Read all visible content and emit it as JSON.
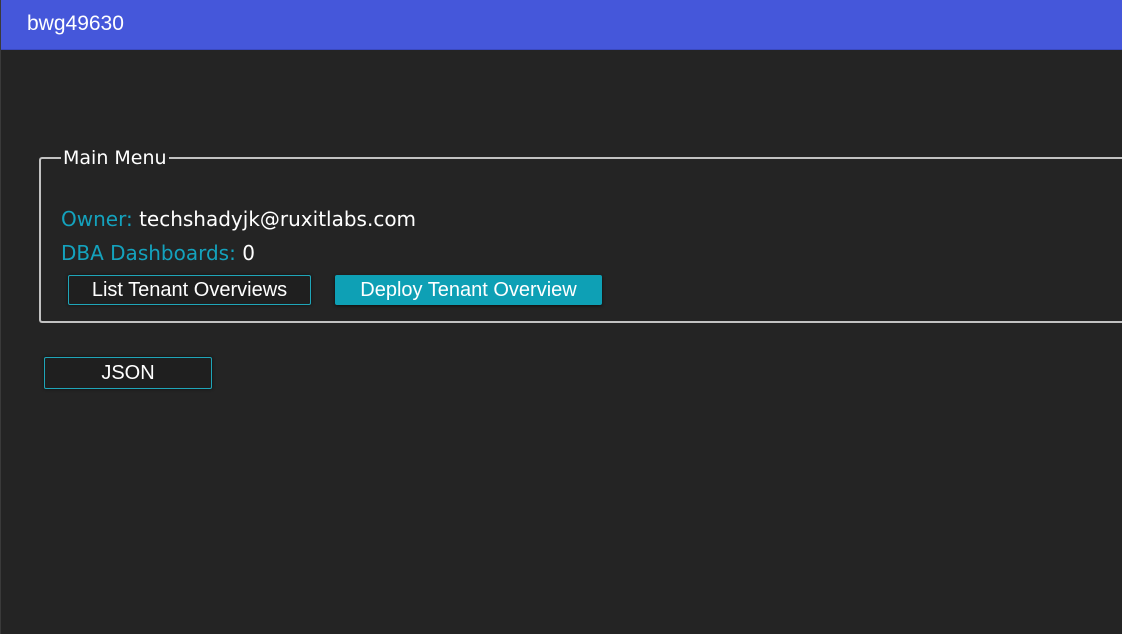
{
  "window": {
    "title": "bwg49630"
  },
  "main_menu": {
    "legend": "Main Menu",
    "owner_label": "Owner:",
    "owner_value": "techshadyjk@ruxitlabs.com",
    "dba_label": "DBA Dashboards:",
    "dba_value": "0",
    "buttons": {
      "list_label": "List Tenant Overviews",
      "deploy_label": "Deploy Tenant Overview"
    }
  },
  "json_button": {
    "label": "JSON"
  },
  "colors": {
    "titlebar": "#4557da",
    "background": "#242424",
    "accent": "#0ea0b5",
    "label_teal": "#14a2bd"
  }
}
